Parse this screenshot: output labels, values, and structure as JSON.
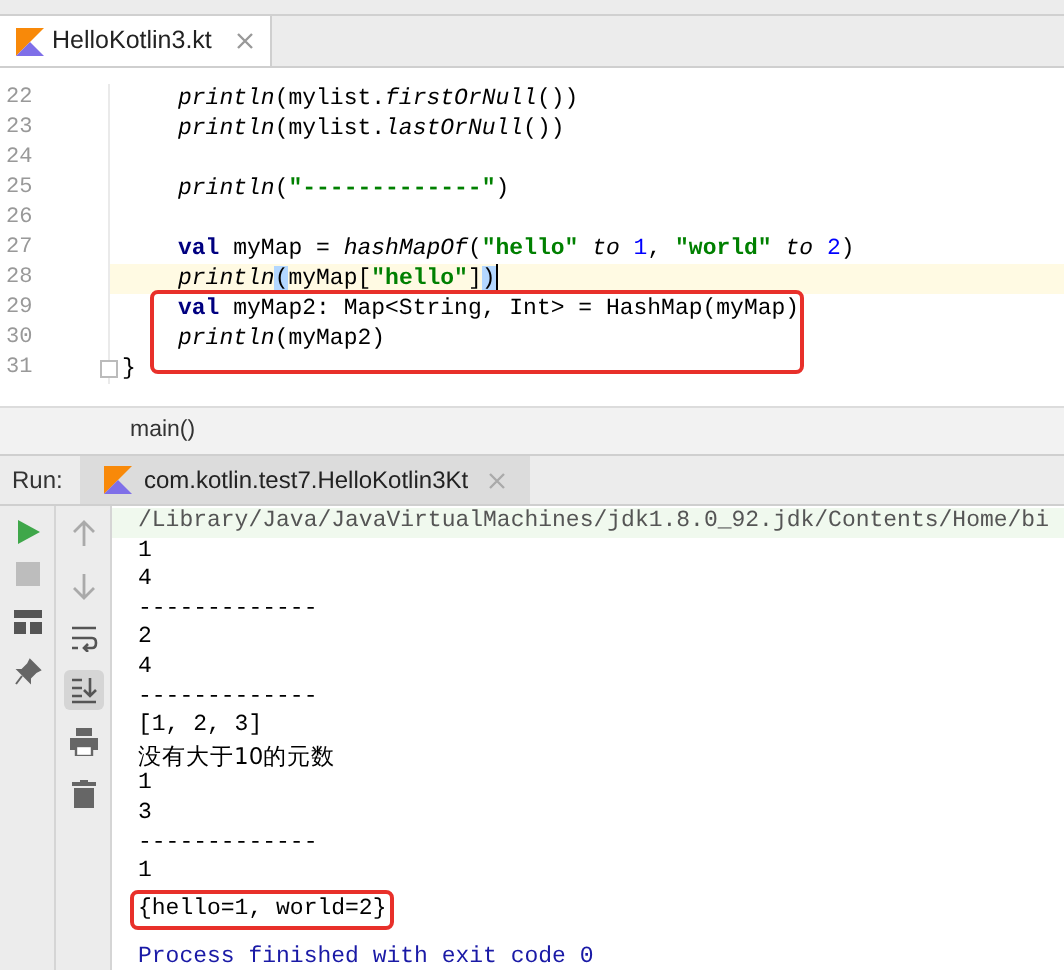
{
  "editor_tabs": [
    {
      "label": "HelloKotlin3.kt",
      "selected": true
    }
  ],
  "code_lines": [
    {
      "number": "22",
      "segments": [
        {
          "kind": "fn",
          "text": "println"
        },
        {
          "kind": "plain",
          "text": "(mylist."
        },
        {
          "kind": "fn",
          "text": "firstOrNull"
        },
        {
          "kind": "plain",
          "text": "())"
        }
      ]
    },
    {
      "number": "23",
      "segments": [
        {
          "kind": "fn",
          "text": "println"
        },
        {
          "kind": "plain",
          "text": "(mylist."
        },
        {
          "kind": "fn",
          "text": "lastOrNull"
        },
        {
          "kind": "plain",
          "text": "())"
        }
      ]
    },
    {
      "number": "24"
    },
    {
      "number": "25",
      "segments": [
        {
          "kind": "fn",
          "text": "println"
        },
        {
          "kind": "plain",
          "text": "("
        },
        {
          "kind": "string",
          "text": "\"-------------\""
        },
        {
          "kind": "plain",
          "text": ")"
        }
      ]
    },
    {
      "number": "26"
    },
    {
      "number": "27",
      "segments": [
        {
          "kind": "keyword",
          "text": "val"
        },
        {
          "kind": "plain",
          "text": " myMap = "
        },
        {
          "kind": "fn",
          "text": "hashMapOf"
        },
        {
          "kind": "plain",
          "text": "("
        },
        {
          "kind": "string",
          "text": "\"hello\""
        },
        {
          "kind": "fn",
          "text": " to "
        },
        {
          "kind": "number",
          "text": "1"
        },
        {
          "kind": "plain",
          "text": ", "
        },
        {
          "kind": "string",
          "text": "\"world\""
        },
        {
          "kind": "fn",
          "text": " to "
        },
        {
          "kind": "number",
          "text": "2"
        },
        {
          "kind": "plain",
          "text": ")"
        }
      ]
    },
    {
      "number": "28",
      "current": true,
      "segments": [
        {
          "kind": "fn",
          "text": "println"
        },
        {
          "kind": "match",
          "text": "("
        },
        {
          "kind": "plain",
          "text": "myMap["
        },
        {
          "kind": "string",
          "text": "\"hello\""
        },
        {
          "kind": "plain",
          "text": "]"
        },
        {
          "kind": "match",
          "text": ")"
        }
      ]
    },
    {
      "number": "29",
      "boxed": true,
      "segments": [
        {
          "kind": "keyword",
          "text": "val"
        },
        {
          "kind": "plain",
          "text": " myMap2: Map<String, Int> = HashMap(myMap)"
        }
      ]
    },
    {
      "number": "30",
      "boxed": true,
      "segments": [
        {
          "kind": "fn",
          "text": "println"
        },
        {
          "kind": "plain",
          "text": "(myMap2)"
        }
      ]
    },
    {
      "number": "31",
      "outdent": true,
      "fold": true,
      "segments": [
        {
          "kind": "plain",
          "text": "}"
        }
      ]
    }
  ],
  "breadcrumb": "main()",
  "run_panel": {
    "label": "Run:",
    "tabs": [
      {
        "label": "com.kotlin.test7.HelloKotlin3Kt",
        "selected": true
      }
    ]
  },
  "console": [
    {
      "kind": "command",
      "text": "/Library/Java/JavaVirtualMachines/jdk1.8.0_92.jdk/Contents/Home/bi"
    },
    {
      "kind": "output",
      "text": "1"
    },
    {
      "kind": "output",
      "text": "4"
    },
    {
      "kind": "output",
      "text": "-------------"
    },
    {
      "kind": "output",
      "text": "2"
    },
    {
      "kind": "output",
      "text": "4"
    },
    {
      "kind": "output",
      "text": "-------------"
    },
    {
      "kind": "output",
      "text": "[1, 2, 3]"
    },
    {
      "kind": "output",
      "text": "没有大于10的元数"
    },
    {
      "kind": "output",
      "text": "1"
    },
    {
      "kind": "output",
      "text": "3"
    },
    {
      "kind": "output",
      "text": "-------------"
    },
    {
      "kind": "output",
      "text": "1"
    },
    {
      "kind": "output",
      "text": "{hello=1, world=2}",
      "boxed": true
    },
    {
      "kind": "exit",
      "text": "Process finished with exit code 0"
    }
  ],
  "scroll_to_end": {
    "selected": true
  }
}
